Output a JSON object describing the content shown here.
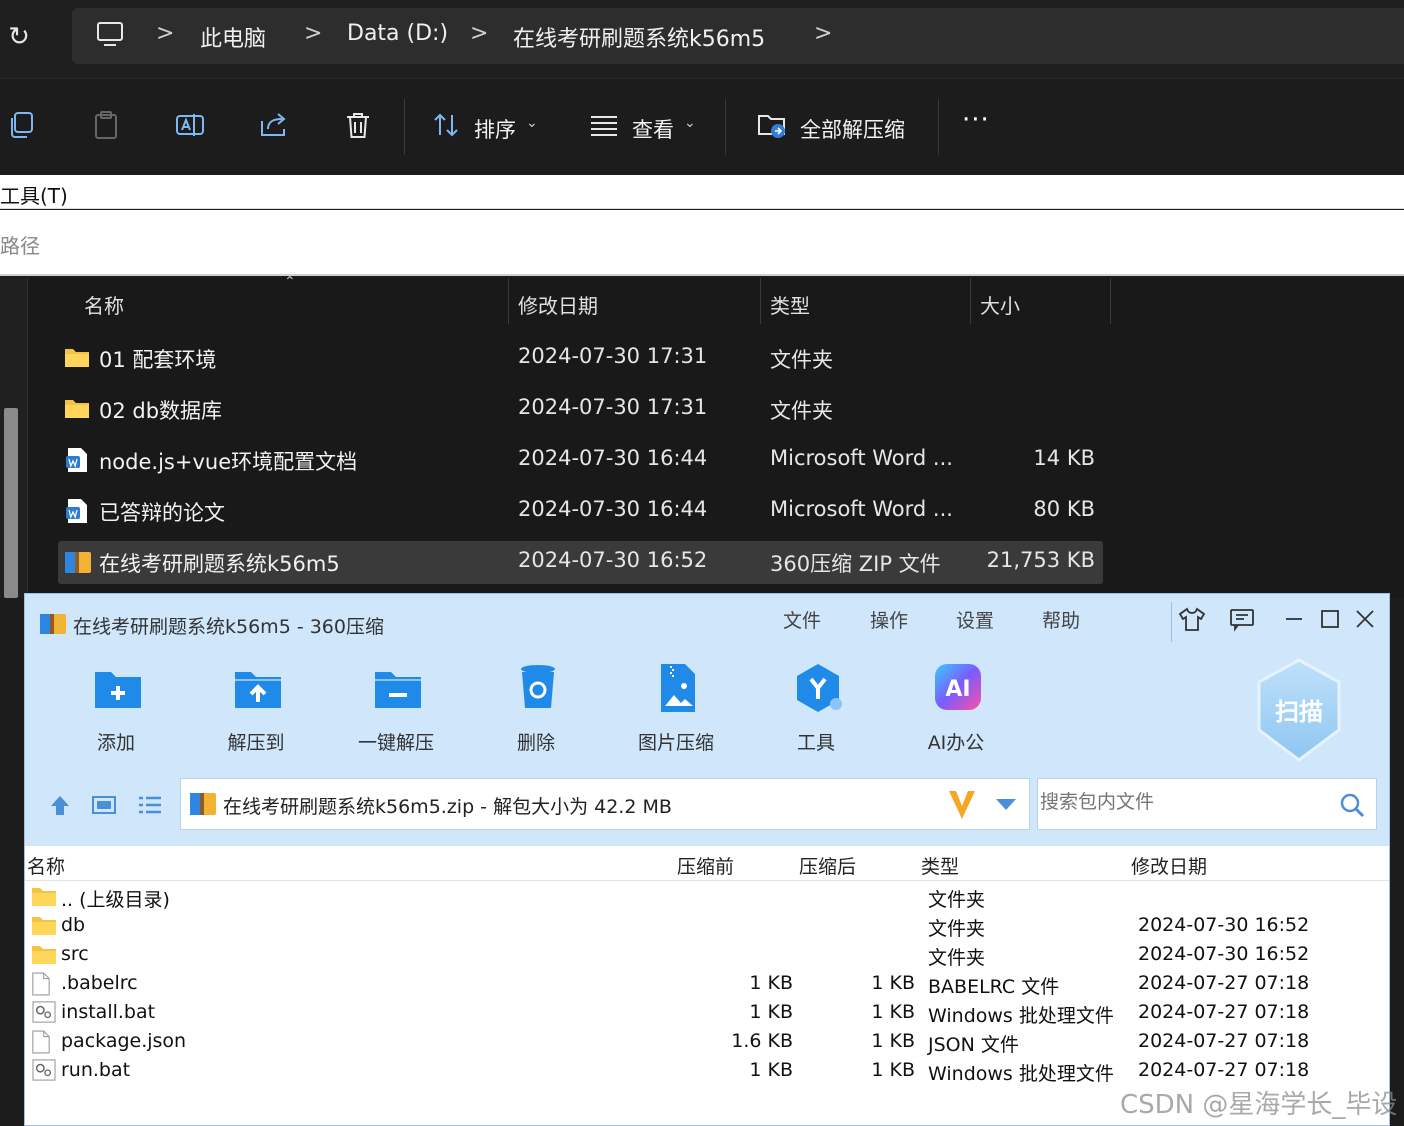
{
  "explorer": {
    "breadcrumb": [
      "此电脑",
      "Data (D:)",
      "在线考研刷题系统k56m5"
    ],
    "sep": ">",
    "toolbar": {
      "sort_label": "排序",
      "view_label": "查看",
      "extract_all_label": "全部解压缩",
      "more_label": "···"
    },
    "menu_text": "工具(T)",
    "path_text": "路径",
    "columns": [
      "名称",
      "修改日期",
      "类型",
      "大小"
    ],
    "files": [
      {
        "name": "01 配套环境",
        "date": "2024-07-30 17:31",
        "type": "文件夹",
        "size": "",
        "icon": "folder"
      },
      {
        "name": "02 db数据库",
        "date": "2024-07-30 17:31",
        "type": "文件夹",
        "size": "",
        "icon": "folder"
      },
      {
        "name": "node.js+vue环境配置文档",
        "date": "2024-07-30 16:44",
        "type": "Microsoft Word ...",
        "size": "14 KB",
        "icon": "word"
      },
      {
        "name": "已答辩的论文",
        "date": "2024-07-30 16:44",
        "type": "Microsoft Word ...",
        "size": "80 KB",
        "icon": "word"
      },
      {
        "name": "在线考研刷题系统k56m5",
        "date": "2024-07-30 16:52",
        "type": "360压缩 ZIP 文件",
        "size": "21,753 KB",
        "icon": "zip",
        "selected": true
      }
    ]
  },
  "zip_window": {
    "title": "在线考研刷题系统k56m5 - 360压缩",
    "menu": [
      "文件",
      "操作",
      "设置",
      "帮助"
    ],
    "toolbar": [
      {
        "label": "添加",
        "icon": "add-icon"
      },
      {
        "label": "解压到",
        "icon": "extract-to-icon"
      },
      {
        "label": "一键解压",
        "icon": "one-click-extract-icon"
      },
      {
        "label": "删除",
        "icon": "delete-icon"
      },
      {
        "label": "图片压缩",
        "icon": "image-compress-icon"
      },
      {
        "label": "工具",
        "icon": "tools-icon"
      },
      {
        "label": "AI办公",
        "icon": "ai-office-icon"
      }
    ],
    "ai_badge": "AI",
    "scan_label": "扫描",
    "path_text": "在线考研刷题系统k56m5.zip - 解包大小为 42.2 MB",
    "search_placeholder": "搜索包内文件",
    "columns": [
      "名称",
      "压缩前",
      "压缩后",
      "类型",
      "修改日期"
    ],
    "files": [
      {
        "name": ".. (上级目录)",
        "before": "",
        "after": "",
        "type": "文件夹",
        "date": "",
        "icon": "folder"
      },
      {
        "name": "db",
        "before": "",
        "after": "",
        "type": "文件夹",
        "date": "2024-07-30 16:52",
        "icon": "folder"
      },
      {
        "name": "src",
        "before": "",
        "after": "",
        "type": "文件夹",
        "date": "2024-07-30 16:52",
        "icon": "folder"
      },
      {
        "name": ".babelrc",
        "before": "1 KB",
        "after": "1 KB",
        "type": "BABELRC 文件",
        "date": "2024-07-27 07:18",
        "icon": "file"
      },
      {
        "name": "install.bat",
        "before": "1 KB",
        "after": "1 KB",
        "type": "Windows 批处理文件",
        "date": "2024-07-27 07:18",
        "icon": "bat"
      },
      {
        "name": "package.json",
        "before": "1.6 KB",
        "after": "1 KB",
        "type": "JSON 文件",
        "date": "2024-07-27 07:18",
        "icon": "file"
      },
      {
        "name": "run.bat",
        "before": "1 KB",
        "after": "1 KB",
        "type": "Windows 批处理文件",
        "date": "2024-07-27 07:18",
        "icon": "bat"
      }
    ]
  },
  "watermark": "CSDN @星海学长_毕设",
  "colors": {
    "explorer_bg": "#191919",
    "zip_bg": "#cfe6fb",
    "folder": "#f5c342",
    "word_blue": "#2b7cd3",
    "zip_blue": "#1e88e5"
  }
}
